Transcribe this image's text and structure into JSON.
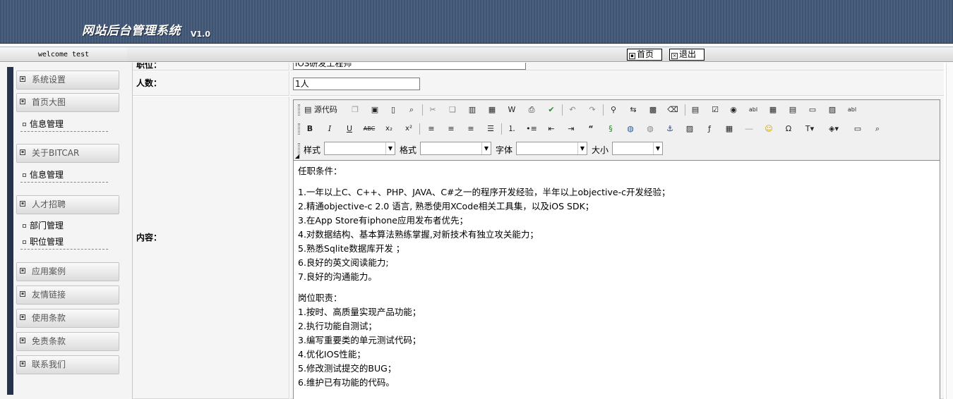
{
  "header": {
    "title": "网站后台管理系统",
    "version": "V1.0"
  },
  "welcome": "welcome test",
  "topbar": {
    "home_label": "首页",
    "exit_label": "退出"
  },
  "sidebar": {
    "groups": [
      {
        "label": "系统设置",
        "subs": []
      },
      {
        "label": "首页大图",
        "subs": [
          "信息管理"
        ]
      },
      {
        "label": "关于BITCAR",
        "subs": [
          "信息管理"
        ]
      },
      {
        "label": "人才招聘",
        "subs": [
          "部门管理",
          "职位管理"
        ]
      },
      {
        "label": "应用案例",
        "subs": []
      },
      {
        "label": "友情链接",
        "subs": []
      },
      {
        "label": "使用条款",
        "subs": []
      },
      {
        "label": "免责条款",
        "subs": []
      },
      {
        "label": "联系我们",
        "subs": []
      }
    ]
  },
  "form": {
    "position_label": "职位：",
    "position_value": "iOS研发工程师",
    "count_label": "人数：",
    "count_value": "1人",
    "content_label": "内容："
  },
  "editor": {
    "source_label": "源代码",
    "style_label": "样式",
    "format_label": "格式",
    "font_label": "字体",
    "size_label": "大小",
    "lines": [
      "任职条件：",
      "",
      "1.一年以上C、C++、PHP、JAVA、C#之一的程序开发经验，半年以上objective-c开发经验；",
      "2.精通objective-c 2.0 语言, 熟悉使用XCode相关工具集，以及iOS SDK；",
      "3.在App Store有iphone应用发布者优先；",
      "4.对数据结构、基本算法熟练掌握,对新技术有独立攻关能力；",
      "5.熟悉Sqlite数据库开发 ；",
      "6.良好的英文阅读能力;",
      "7.良好的沟通能力。",
      "",
      "岗位职责：",
      "1.按时、高质量实现产品功能；",
      "2.执行功能自测试；",
      "3.编写重要类的单元测试代码；",
      "4.优化IOS性能；",
      "5.修改测试提交的BUG；",
      "6.维护已有功能的代码。"
    ]
  }
}
